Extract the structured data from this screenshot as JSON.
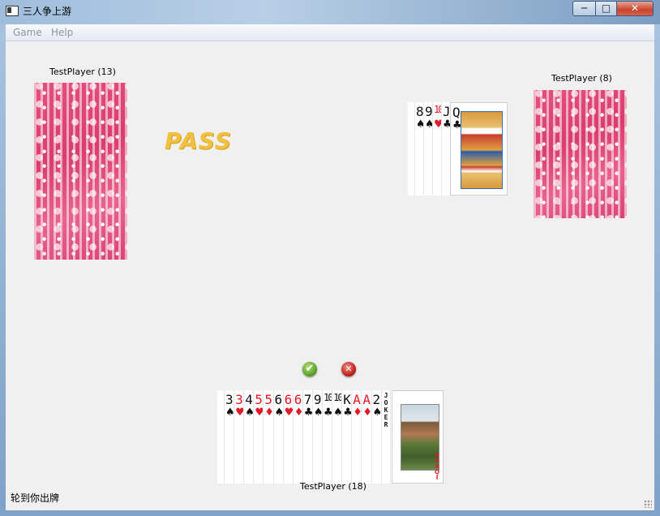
{
  "window": {
    "title": "三人争上游",
    "controls": [
      "─",
      "□",
      "✕"
    ]
  },
  "menu": [
    "Game",
    "Help"
  ],
  "players": {
    "left": {
      "label": "TestPlayer (13)"
    },
    "right": {
      "label": "TestPlayer (8)"
    },
    "bottom": {
      "label": "TestPlayer (18)"
    }
  },
  "pass_text": "PASS",
  "played_cards": [
    {
      "rank": "8",
      "suit": "♠",
      "color": "black"
    },
    {
      "rank": "9",
      "suit": "♠",
      "color": "black"
    },
    {
      "rank": "10",
      "suit": "♥",
      "color": "red"
    },
    {
      "rank": "J",
      "suit": "♣",
      "color": "black"
    },
    {
      "rank": "Q",
      "suit": "♣",
      "color": "black"
    }
  ],
  "played_face": {
    "rank": "Q",
    "suit": "♣"
  },
  "hand_cards": [
    {
      "rank": "3",
      "suit": "♠",
      "color": "black"
    },
    {
      "rank": "3",
      "suit": "♥",
      "color": "red"
    },
    {
      "rank": "4",
      "suit": "♠",
      "color": "black"
    },
    {
      "rank": "5",
      "suit": "♥",
      "color": "red"
    },
    {
      "rank": "5",
      "suit": "♦",
      "color": "red"
    },
    {
      "rank": "6",
      "suit": "♠",
      "color": "black"
    },
    {
      "rank": "6",
      "suit": "♥",
      "color": "red"
    },
    {
      "rank": "6",
      "suit": "♦",
      "color": "red"
    },
    {
      "rank": "7",
      "suit": "♣",
      "color": "black"
    },
    {
      "rank": "9",
      "suit": "♠",
      "color": "black"
    },
    {
      "rank": "10",
      "suit": "♣",
      "color": "black"
    },
    {
      "rank": "10",
      "suit": "♠",
      "color": "black"
    },
    {
      "rank": "K",
      "suit": "♣",
      "color": "black"
    },
    {
      "rank": "A",
      "suit": "♦",
      "color": "red"
    },
    {
      "rank": "A",
      "suit": "♦",
      "color": "red"
    },
    {
      "rank": "2",
      "suit": "♠",
      "color": "black"
    }
  ],
  "jokers": [
    {
      "text": "JOKER",
      "color": "black"
    },
    {
      "text": "JOKER",
      "color": "red"
    }
  ],
  "buttons": {
    "ok": "✔",
    "cancel": "✕"
  },
  "status_text": "轮到你出牌"
}
